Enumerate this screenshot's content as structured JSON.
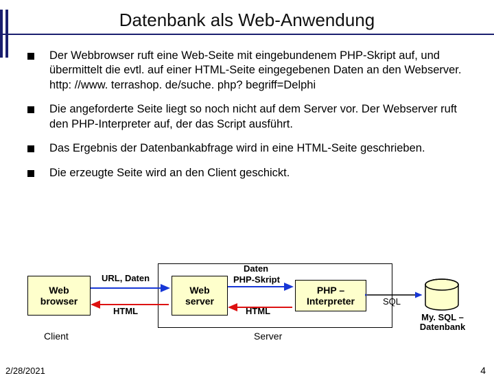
{
  "title": "Datenbank als Web-Anwendung",
  "bullets": [
    "Der Webbrowser ruft eine Web-Seite mit eingebundenem PHP-Skript auf, und übermittelt die evtl. auf einer HTML-Seite eingegebenen Daten an den Webserver. http: //www. terrashop. de/suche. php? begriff=Delphi",
    "Die angeforderte Seite liegt so noch nicht auf dem Server vor. Der Webserver ruft den PHP-Interpreter auf, der das Script ausführt.",
    "Das Ergebnis der Datenbankabfrage wird in eine HTML-Seite geschrieben.",
    "Die erzeugte Seite wird an den Client geschickt."
  ],
  "diagram": {
    "browser": "Web\nbrowser",
    "webserver": "Web\nserver",
    "interpreter": "PHP –\nInterpreter",
    "url_daten": "URL, Daten",
    "html": "HTML",
    "daten": "Daten",
    "php_skript": "PHP-Skript",
    "html2": "HTML",
    "sql": "SQL",
    "db": "My. SQL –\nDatenbank",
    "client": "Client",
    "server": "Server"
  },
  "footer": {
    "date": "2/28/2021",
    "page": "4"
  }
}
